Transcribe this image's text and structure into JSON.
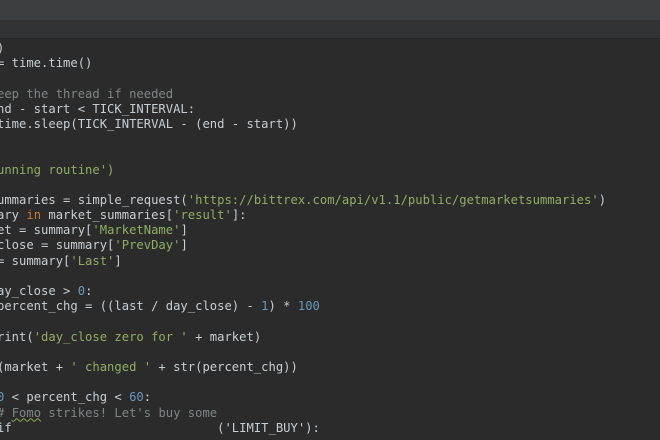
{
  "editor": {
    "lines": [
      [
        {
          "t": ")",
          "c": "plain"
        }
      ],
      [
        {
          "t": "= time.time()",
          "c": "plain"
        }
      ],
      [],
      [
        {
          "t": "eep the thread if needed",
          "c": "com"
        }
      ],
      [
        {
          "t": "nd - start < TICK_INTERVAL:",
          "c": "plain"
        }
      ],
      [
        {
          "t": "time.sleep(TICK_INTERVAL - (end - start))",
          "c": "plain"
        }
      ],
      [],
      [],
      [
        {
          "t": "unning routine')",
          "c": "str"
        }
      ],
      [],
      [
        {
          "t": "ummaries = simple_request(",
          "c": "plain"
        },
        {
          "t": "'https://bittrex.com/api/v1.1/public/getmarketsummaries'",
          "c": "str"
        },
        {
          "t": ")",
          "c": "plain"
        }
      ],
      [
        {
          "t": "ary ",
          "c": "plain"
        },
        {
          "t": "in",
          "c": "kw"
        },
        {
          "t": " market_summaries[",
          "c": "plain"
        },
        {
          "t": "'result'",
          "c": "str"
        },
        {
          "t": "]:",
          "c": "plain"
        }
      ],
      [
        {
          "t": "et = summary[",
          "c": "plain"
        },
        {
          "t": "'MarketName'",
          "c": "str"
        },
        {
          "t": "]",
          "c": "plain"
        }
      ],
      [
        {
          "t": "close = summary[",
          "c": "plain"
        },
        {
          "t": "'PrevDay'",
          "c": "str"
        },
        {
          "t": "]",
          "c": "plain"
        }
      ],
      [
        {
          "t": "= summary[",
          "c": "plain"
        },
        {
          "t": "'Last'",
          "c": "str"
        },
        {
          "t": "]",
          "c": "plain"
        }
      ],
      [],
      [
        {
          "t": "ay_close > ",
          "c": "plain"
        },
        {
          "t": "0",
          "c": "num"
        },
        {
          "t": ":",
          "c": "plain"
        }
      ],
      [
        {
          "t": "percent_chg = ((last / day_close) - ",
          "c": "plain"
        },
        {
          "t": "1",
          "c": "num"
        },
        {
          "t": ") * ",
          "c": "plain"
        },
        {
          "t": "100",
          "c": "num"
        }
      ],
      [],
      [
        {
          "t": "rint(",
          "c": "plain"
        },
        {
          "t": "'day_close zero for '",
          "c": "str"
        },
        {
          "t": " + market)",
          "c": "plain"
        }
      ],
      [],
      [
        {
          "t": "(market + ",
          "c": "plain"
        },
        {
          "t": "' changed '",
          "c": "str"
        },
        {
          "t": " + str(percent_chg))",
          "c": "plain"
        }
      ],
      [],
      [
        {
          "t": "0",
          "c": "num"
        },
        {
          "t": " < percent_chg < ",
          "c": "plain"
        },
        {
          "t": "60",
          "c": "num"
        },
        {
          "t": ":",
          "c": "plain"
        }
      ],
      [
        {
          "t": "# ",
          "c": "com"
        },
        {
          "t": "Fomo",
          "c": "com",
          "sq": true
        },
        {
          "t": " strikes! Let's buy some",
          "c": "com"
        }
      ],
      [
        {
          "t": "if                            ('LIMIT_BUY'):",
          "c": "plain"
        }
      ]
    ]
  }
}
